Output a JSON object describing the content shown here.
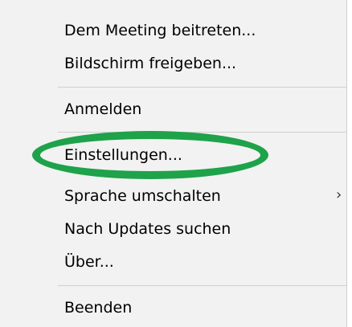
{
  "menu": {
    "items": [
      {
        "label": "Dem Meeting beitreten..."
      },
      {
        "label": "Bildschirm freigeben..."
      },
      {
        "label": "Anmelden"
      },
      {
        "label": "Einstellungen..."
      },
      {
        "label": "Sprache umschalten",
        "submenu_arrow": "›"
      },
      {
        "label": "Nach Updates suchen"
      },
      {
        "label": "Über..."
      },
      {
        "label": "Beenden"
      }
    ]
  },
  "highlight": {
    "color": "#1ea24a",
    "target": "Einstellungen..."
  }
}
